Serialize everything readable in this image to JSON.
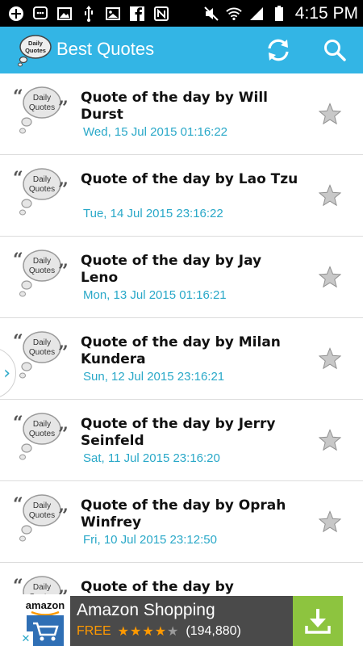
{
  "status_bar": {
    "time": "4:15 PM",
    "left_icons": [
      "add-icon",
      "chat-icon",
      "gallery-icon",
      "usb-icon",
      "image-icon",
      "facebook-icon",
      "nfc-icon"
    ],
    "right_icons": [
      "mute-icon",
      "wifi-icon",
      "signal-icon",
      "battery-icon"
    ]
  },
  "action_bar": {
    "logo_text_line1": "Daily",
    "logo_text_line2": "Quotes",
    "title": "Best Quotes",
    "refresh_icon": "refresh-icon",
    "search_icon": "search-icon",
    "color": "#33b5e5"
  },
  "thumbnail": {
    "line1": "Daily",
    "line2": "Quotes"
  },
  "quotes": [
    {
      "title": "Quote of the day by  Will Durst",
      "date": "Wed, 15 Jul 2015 01:16:22"
    },
    {
      "title": "Quote of the day by  Lao Tzu",
      "date": "Tue, 14 Jul 2015 23:16:22"
    },
    {
      "title": "Quote of the day by  Jay Leno",
      "date": "Mon, 13 Jul 2015 01:16:21"
    },
    {
      "title": "Quote of the day by  Milan Kundera",
      "date": "Sun, 12 Jul 2015 23:16:21"
    },
    {
      "title": "Quote of the day by  Jerry Seinfeld",
      "date": "Sat, 11 Jul 2015 23:16:20"
    },
    {
      "title": "Quote of the day by  Oprah Winfrey",
      "date": "Fri, 10 Jul 2015 23:12:50"
    },
    {
      "title": "Quote of the day by  Mohandas",
      "date": ""
    }
  ],
  "drawer_handle": "›",
  "ad": {
    "logo_text": "amazon",
    "title": "Amazon Shopping",
    "price": "FREE",
    "stars_on": "★★★★",
    "stars_off": "★",
    "rating_count": "(194,880)",
    "close": "✕",
    "download_color": "#8dc43f"
  }
}
